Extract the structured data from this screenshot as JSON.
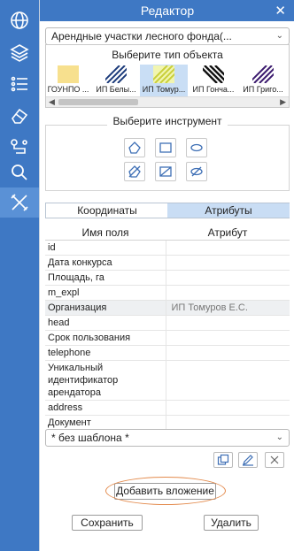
{
  "rail": {
    "items": [
      {
        "icon": "globe-icon",
        "active": false
      },
      {
        "icon": "layers-icon",
        "active": false
      },
      {
        "icon": "legend-list-icon",
        "active": false
      },
      {
        "icon": "eraser-icon",
        "active": false
      },
      {
        "icon": "route-icon",
        "active": false
      },
      {
        "icon": "search-icon",
        "active": false
      },
      {
        "icon": "tools-cross-icon",
        "active": true
      }
    ]
  },
  "editor": {
    "title": "Редактор",
    "close_glyph": "✕",
    "layer_select": "Арендные участки лесного фонда(...",
    "object_type_title": "Выберите тип объекта",
    "object_types": [
      {
        "label": "ГОУНПО ...",
        "pattern": "solid-yellow"
      },
      {
        "label": "ИП Белы...",
        "pattern": "hatch-blue"
      },
      {
        "label": "ИП Томур...",
        "pattern": "hatch-yellow",
        "selected": true
      },
      {
        "label": "ИП Гонча...",
        "pattern": "hatch-black"
      },
      {
        "label": "ИП Григо...",
        "pattern": "hatch-purple"
      }
    ],
    "tool_title": "Выберите инструмент",
    "tabs": [
      {
        "label": "Координаты",
        "active": false
      },
      {
        "label": "Атрибуты",
        "active": true
      }
    ],
    "attr_table": {
      "headers": [
        "Имя поля",
        "Атрибут"
      ],
      "rows": [
        {
          "name": "id",
          "value": ""
        },
        {
          "name": "Дата конкурса",
          "value": ""
        },
        {
          "name": "Площадь, га",
          "value": ""
        },
        {
          "name": "m_expl",
          "value": ""
        },
        {
          "name": "Организация",
          "value": "ИП Томуров Е.С."
        },
        {
          "name": "head",
          "value": ""
        },
        {
          "name": "Срок пользования",
          "value": ""
        },
        {
          "name": "telephone",
          "value": ""
        },
        {
          "name": "Уникальный идентификатор арендатора",
          "value": ""
        },
        {
          "name": "address",
          "value": ""
        },
        {
          "name": "Документ",
          "value": ""
        }
      ]
    },
    "template_select": "* без шаблона *",
    "attach_button": "Добавить вложение",
    "save_button": "Сохранить",
    "delete_button": "Удалить"
  },
  "colors": {
    "rail": "#3e78c4",
    "accent_ring": "#e38a4c",
    "selected_tab": "#c9ddf4"
  }
}
